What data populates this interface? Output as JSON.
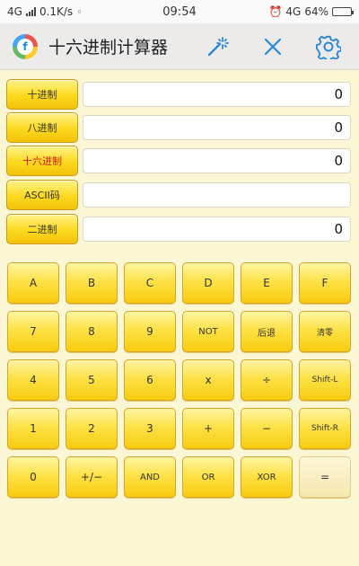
{
  "status_bar": {
    "network": "4G",
    "speed": "0.1K/s",
    "time": "09:54",
    "network2": "4G",
    "battery": "64%",
    "battery_level": 0.64
  },
  "app_bar": {
    "logo_letter": "f",
    "title": "十六进制计算器",
    "icons": [
      "magic-wand-icon",
      "close-icon",
      "gear-icon"
    ]
  },
  "rows": [
    {
      "label": "十进制",
      "value": "0",
      "active": false
    },
    {
      "label": "八进制",
      "value": "0",
      "active": false
    },
    {
      "label": "十六进制",
      "value": "0",
      "active": true
    },
    {
      "label": "ASCII码",
      "value": "",
      "active": false
    },
    {
      "label": "二进制",
      "value": "0",
      "active": false
    }
  ],
  "keys": [
    {
      "label": "A",
      "name": "key-a"
    },
    {
      "label": "B",
      "name": "key-b"
    },
    {
      "label": "C",
      "name": "key-c"
    },
    {
      "label": "D",
      "name": "key-d"
    },
    {
      "label": "E",
      "name": "key-e"
    },
    {
      "label": "F",
      "name": "key-f"
    },
    {
      "label": "7",
      "name": "key-7"
    },
    {
      "label": "8",
      "name": "key-8"
    },
    {
      "label": "9",
      "name": "key-9"
    },
    {
      "label": "NOT",
      "name": "key-not"
    },
    {
      "label": "后退",
      "name": "key-backspace"
    },
    {
      "label": "清零",
      "name": "key-clear"
    },
    {
      "label": "4",
      "name": "key-4"
    },
    {
      "label": "5",
      "name": "key-5"
    },
    {
      "label": "6",
      "name": "key-6"
    },
    {
      "label": "x",
      "name": "key-multiply"
    },
    {
      "label": "÷",
      "name": "key-divide"
    },
    {
      "label": "Shift-L",
      "name": "key-shift-left"
    },
    {
      "label": "1",
      "name": "key-1"
    },
    {
      "label": "2",
      "name": "key-2"
    },
    {
      "label": "3",
      "name": "key-3"
    },
    {
      "label": "+",
      "name": "key-plus"
    },
    {
      "label": "−",
      "name": "key-minus"
    },
    {
      "label": "Shift-R",
      "name": "key-shift-right"
    },
    {
      "label": "0",
      "name": "key-0"
    },
    {
      "label": "+/−",
      "name": "key-negate"
    },
    {
      "label": "AND",
      "name": "key-and"
    },
    {
      "label": "OR",
      "name": "key-or"
    },
    {
      "label": "XOR",
      "name": "key-xor"
    },
    {
      "label": "=",
      "name": "key-equals"
    }
  ]
}
